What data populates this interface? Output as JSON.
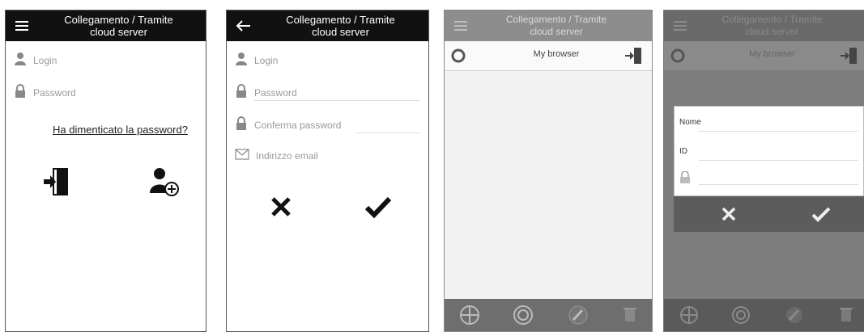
{
  "screen1": {
    "title_line1": "Collegamento / Tramite",
    "title_line2": "cloud server",
    "login_label": "Login",
    "password_label": "Password",
    "forgot_link": "Ha dimenticato la password?",
    "icons": [
      "menu-icon",
      "user-icon",
      "lock-icon",
      "login-door-icon",
      "add-user-icon"
    ]
  },
  "screen2": {
    "title_line1": "Collegamento / Tramite",
    "title_line2": "cloud server",
    "login_label": "Login",
    "password_label": "Password",
    "confirm_label": "Conferma password",
    "email_label": "Indirizzo email",
    "icons": [
      "back-arrow-icon",
      "user-icon",
      "lock-icon",
      "envelope-icon",
      "cancel-x-icon",
      "confirm-check-icon"
    ]
  },
  "screen3": {
    "title_line1": "Collegamento / Tramite",
    "title_line2": "cloud server",
    "device_name": "My browser",
    "icons": [
      "menu-icon",
      "radio-icon",
      "exit-door-icon",
      "crosshair-icon",
      "sync-icon",
      "edit-icon",
      "delete-icon"
    ]
  },
  "screen4": {
    "title_line1": "Collegamento / Tramite",
    "title_line2": "cloud server",
    "device_name": "My browser",
    "dialog_name_label": "Nome",
    "dialog_id_label": "ID",
    "icons": [
      "menu-icon",
      "radio-icon",
      "exit-door-icon",
      "lock-icon",
      "cancel-x-icon",
      "confirm-check-icon",
      "crosshair-icon",
      "sync-icon",
      "edit-icon",
      "delete-icon"
    ]
  },
  "colors": {
    "header_dark": "#111111",
    "text_muted": "#999999",
    "footer_gray": "#6e6e6e"
  }
}
